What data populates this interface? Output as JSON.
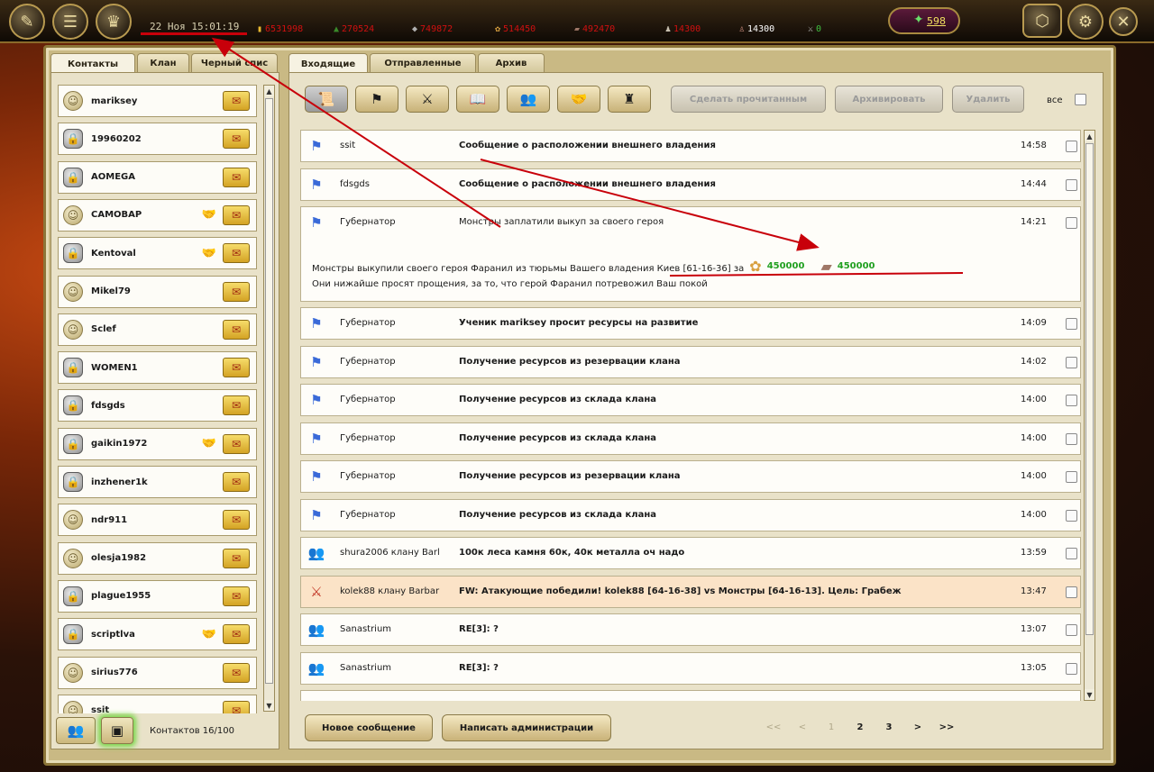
{
  "topbar": {
    "datetime": "22 Ноя 15:01:19",
    "resources": [
      {
        "icon": "gold-icon",
        "value": "6531998"
      },
      {
        "icon": "wood-icon",
        "value": "270524"
      },
      {
        "icon": "stone-icon",
        "value": "749872"
      },
      {
        "icon": "grain-icon",
        "value": "514450"
      },
      {
        "icon": "metal-icon",
        "value": "492470"
      },
      {
        "icon": "army-icon",
        "value": "14300"
      },
      {
        "icon": "population-icon",
        "value": "14300"
      },
      {
        "icon": "hero-icon",
        "value": "0"
      }
    ],
    "gems": "598",
    "colors": {
      "resource_value": "#d01010",
      "accent_gold": "#f0e060"
    }
  },
  "left_tabs": [
    "Контакты",
    "Клан",
    "Черный спис"
  ],
  "contacts": [
    {
      "name": "mariksey",
      "locked": false,
      "ally": false
    },
    {
      "name": "19960202",
      "locked": true,
      "ally": false
    },
    {
      "name": "AOMEGA",
      "locked": true,
      "ally": false
    },
    {
      "name": "CAMOBAP",
      "locked": false,
      "ally": true
    },
    {
      "name": "Kentoval",
      "locked": true,
      "ally": true
    },
    {
      "name": "Mikel79",
      "locked": false,
      "ally": false
    },
    {
      "name": "Sclef",
      "locked": false,
      "ally": false
    },
    {
      "name": "WOMEN1",
      "locked": true,
      "ally": false
    },
    {
      "name": "fdsgds",
      "locked": true,
      "ally": false
    },
    {
      "name": "gaikin1972",
      "locked": true,
      "ally": true
    },
    {
      "name": "inzhener1k",
      "locked": true,
      "ally": false
    },
    {
      "name": "ndr911",
      "locked": false,
      "ally": false
    },
    {
      "name": "olesja1982",
      "locked": false,
      "ally": false
    },
    {
      "name": "plague1955",
      "locked": true,
      "ally": false
    },
    {
      "name": "scriptlva",
      "locked": true,
      "ally": true
    },
    {
      "name": "sirius776",
      "locked": false,
      "ally": false
    },
    {
      "name": "ssit",
      "locked": false,
      "ally": false
    }
  ],
  "contacts_count": "Контактов 16/100",
  "right_tabs": [
    "Входящие",
    "Отправленные",
    "Архив"
  ],
  "actions": {
    "mark_read": "Сделать прочитанным",
    "archive": "Архивировать",
    "delete": "Удалить",
    "all": "все"
  },
  "messages": [
    {
      "icon": "flag-icon",
      "sender": "ssit",
      "subject": "Сообщение о расположении внешнего владения",
      "time": "14:58",
      "bold": true
    },
    {
      "icon": "flag-icon",
      "sender": "fdsgds",
      "subject": "Сообщение о расположении внешнего владения",
      "time": "14:44",
      "bold": true
    },
    {
      "icon": "flag-icon",
      "sender": "Губернатор",
      "subject": "Монстры заплатили выкуп за своего героя",
      "time": "14:21",
      "bold": false,
      "expanded": true,
      "body_line1": "Монстры выкупили своего героя  Фаранил из тюрьмы Вашего владения  Киев [61-16-36] за",
      "body_resources": [
        {
          "icon": "grain-icon",
          "value": "450000"
        },
        {
          "icon": "metal-icon",
          "value": "450000"
        }
      ],
      "body_line2": "Они нижайше просят прощения, за то, что герой Фаранил потревожил Ваш покой"
    },
    {
      "icon": "flag-icon",
      "sender": "Губернатор",
      "subject": "Ученик mariksey просит ресурсы на развитие",
      "time": "14:09",
      "bold": true
    },
    {
      "icon": "flag-icon",
      "sender": "Губернатор",
      "subject": "Получение ресурсов из резервации клана",
      "time": "14:02",
      "bold": true
    },
    {
      "icon": "flag-icon",
      "sender": "Губернатор",
      "subject": "Получение ресурсов из склада клана",
      "time": "14:00",
      "bold": true
    },
    {
      "icon": "flag-icon",
      "sender": "Губернатор",
      "subject": "Получение ресурсов из склада клана",
      "time": "14:00",
      "bold": true
    },
    {
      "icon": "flag-icon",
      "sender": "Губернатор",
      "subject": "Получение ресурсов из резервации клана",
      "time": "14:00",
      "bold": true
    },
    {
      "icon": "flag-icon",
      "sender": "Губернатор",
      "subject": "Получение ресурсов из склада клана",
      "time": "14:00",
      "bold": true
    },
    {
      "icon": "people-icon",
      "sender": "shura2006 клану Barl",
      "subject": "100к леса камня 60к, 40к металла оч надо",
      "time": "13:59",
      "bold": true
    },
    {
      "icon": "sword-icon",
      "sender": "kolek88 клану Barbar",
      "subject": "FW: Атакующие победили! kolek88 [64-16-38] vs Монстры [64-16-13]. Цель: Грабеж",
      "time": "13:47",
      "bold": true,
      "highlight": true
    },
    {
      "icon": "people-icon",
      "sender": "Sanastrium",
      "subject": "RE[3]: ?",
      "time": "13:07",
      "bold": true
    },
    {
      "icon": "people-icon",
      "sender": "Sanastrium",
      "subject": "RE[3]: ?",
      "time": "13:05",
      "bold": true
    }
  ],
  "bottom": {
    "new_message": "Новое сообщение",
    "write_admin": "Написать администрации",
    "pager": [
      "<<",
      "<",
      "1",
      "2",
      "3",
      ">",
      ">>"
    ]
  }
}
